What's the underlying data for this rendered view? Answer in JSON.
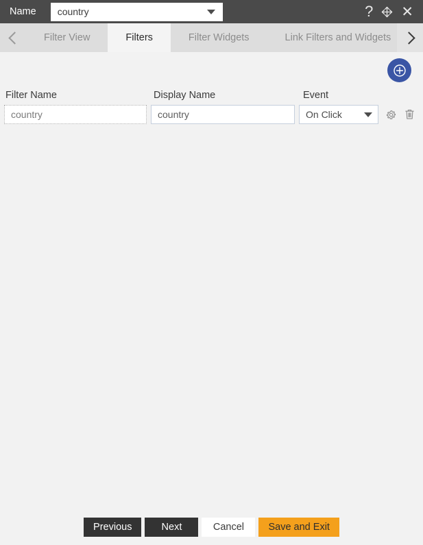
{
  "titlebar": {
    "label": "Name",
    "name_value": "country",
    "help_icon": "question-mark-icon",
    "move_icon": "move-icon",
    "close_icon": "close-icon"
  },
  "tabstrip": {
    "prev_arrow": "chevron-left-icon",
    "next_arrow": "chevron-right-icon",
    "tabs": [
      {
        "label": "Filter View",
        "active": false
      },
      {
        "label": "Filters",
        "active": true
      },
      {
        "label": "Filter Widgets",
        "active": false
      },
      {
        "label": "Link Filters and Widgets",
        "active": false
      }
    ]
  },
  "main": {
    "add_button_icon": "add-circle-icon",
    "columns": {
      "filter_name": "Filter Name",
      "display_name": "Display Name",
      "event": "Event"
    },
    "rows": [
      {
        "filter_name": "country",
        "display_name": "country",
        "event": "On Click",
        "settings_icon": "gear-icon",
        "delete_icon": "trash-icon"
      }
    ]
  },
  "footer": {
    "previous": "Previous",
    "next": "Next",
    "cancel": "Cancel",
    "save_and_exit": "Save and Exit"
  },
  "colors": {
    "titlebar": "#4a4a4a",
    "tab_inactive": "#dddddd",
    "tab_active": "#f4f4f4",
    "content_bg": "#f2f2f2",
    "accent_blue": "#3a55a5",
    "accent_orange": "#f4a01c",
    "button_dark": "#333333"
  }
}
